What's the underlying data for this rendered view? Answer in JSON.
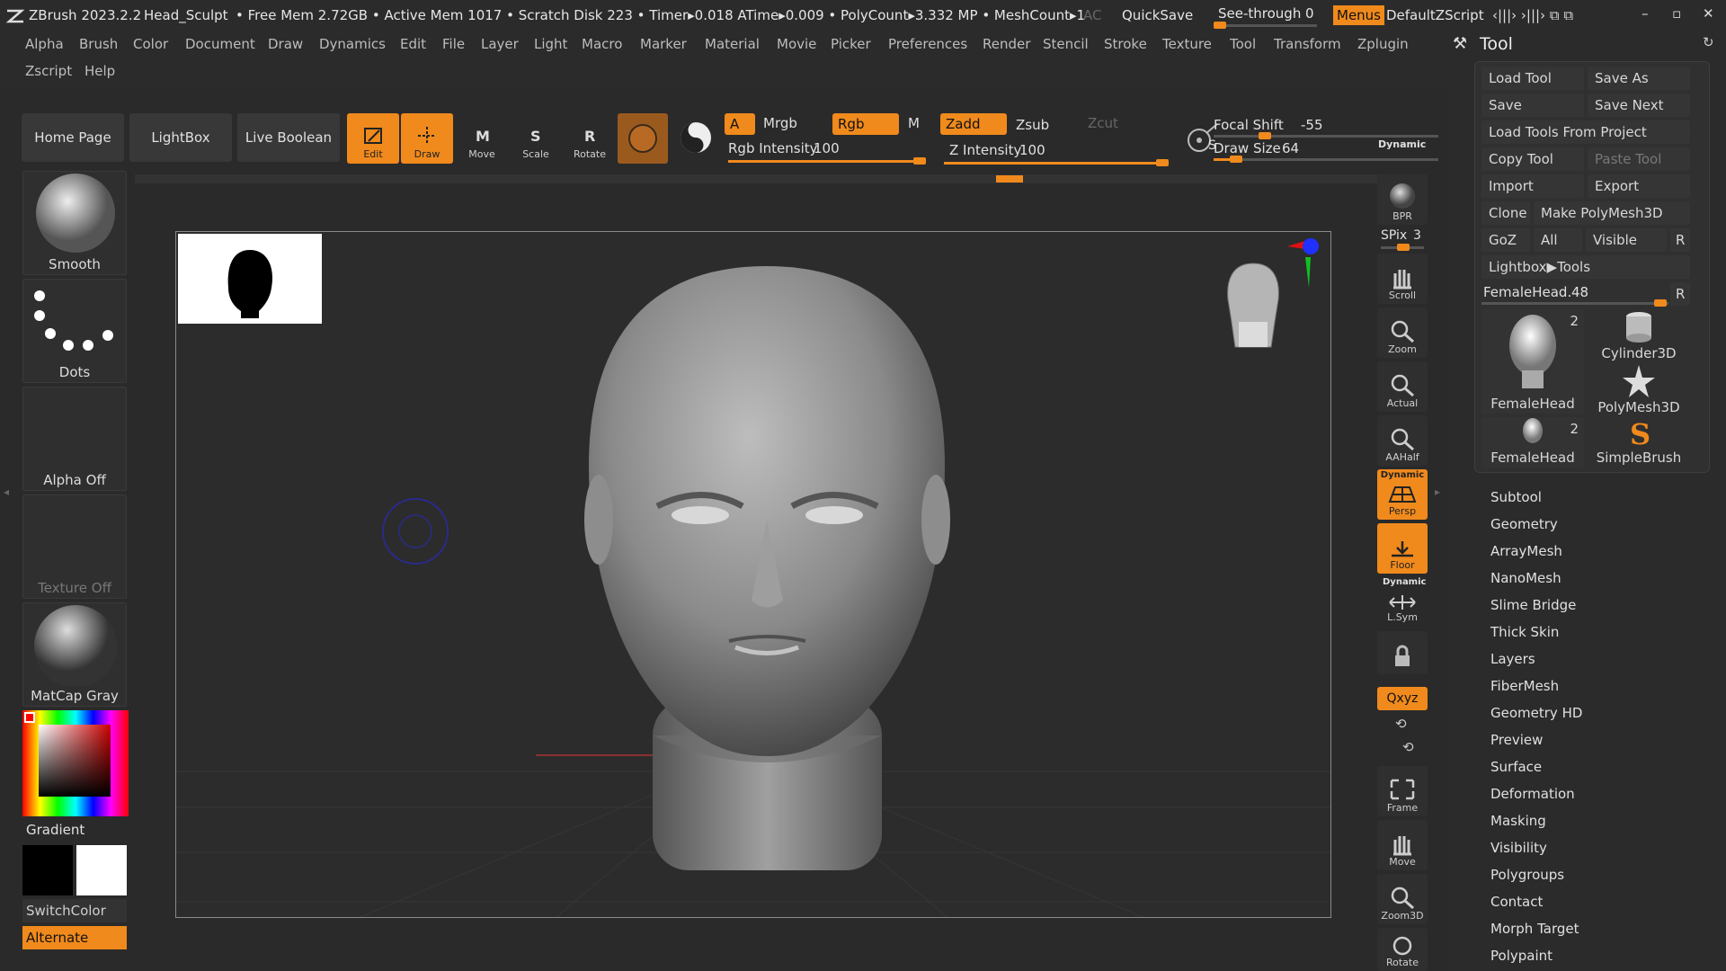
{
  "titlebar": {
    "app": "ZBrush 2023.2.2",
    "doc": "Head_Sculpt",
    "stats": "• Free Mem 2.72GB • Active Mem 1017 • Scratch Disk 223 •  Timer▸0.018 ATime▸0.009 • PolyCount▸3.332 MP  • MeshCount▸1",
    "ac": "AC",
    "quicksave": "QuickSave",
    "seethrough": "See-through",
    "seethrough_value": "0",
    "menus": "Menus",
    "script": "DefaultZScript"
  },
  "menus": [
    "Alpha",
    "Brush",
    "Color",
    "Document",
    "Draw",
    "Dynamics",
    "Edit",
    "File",
    "Layer",
    "Light",
    "Macro",
    "Marker",
    "Material",
    "Movie",
    "Picker",
    "Preferences",
    "Render",
    "Stencil",
    "Stroke",
    "Texture",
    "Tool",
    "Transform",
    "Zplugin",
    "Zscript",
    "Help"
  ],
  "shelf": {
    "home": "Home Page",
    "lightbox": "LightBox",
    "liveboolean": "Live Boolean",
    "edit": "Edit",
    "draw": "Draw",
    "move": "Move",
    "scale": "Scale",
    "rotate": "Rotate",
    "a": "A",
    "mrgb": "Mrgb",
    "rgb": "Rgb",
    "m": "M",
    "zadd": "Zadd",
    "zsub": "Zsub",
    "zcut": "Zcut",
    "rgb_intensity_label": "Rgb Intensity",
    "rgb_intensity": "100",
    "z_intensity_label": "Z Intensity",
    "z_intensity": "100",
    "focal_label": "Focal Shift",
    "focal": "-55",
    "draw_size_label": "Draw Size",
    "draw_size": "64",
    "dynamic": "Dynamic",
    "s": "S"
  },
  "left": {
    "brush": "Smooth",
    "stroke": "Dots",
    "alpha": "Alpha Off",
    "texture": "Texture Off",
    "material": "MatCap Gray",
    "gradient": "Gradient",
    "switchcolor": "SwitchColor",
    "alternate": "Alternate"
  },
  "nav": {
    "bpr": "BPR",
    "spix_label": "SPix",
    "spix": "3",
    "scroll": "Scroll",
    "zoom": "Zoom",
    "actual": "Actual",
    "aahalf": "AAHalf",
    "dynamic": "Dynamic",
    "persp": "Persp",
    "floor": "Floor",
    "dynamic2": "Dynamic",
    "lsym": "L.Sym",
    "xyz": "Qxyz",
    "frame": "Frame",
    "move": "Move",
    "zoom3d": "Zoom3D",
    "rotate": "Rotate"
  },
  "tool": {
    "title": "Tool",
    "load": "Load Tool",
    "saveas": "Save As",
    "save": "Save",
    "savenext": "Save Next",
    "loadproject": "Load Tools From Project",
    "copy": "Copy Tool",
    "paste": "Paste Tool",
    "import": "Import",
    "export": "Export",
    "clone": "Clone",
    "makepoly": "Make PolyMesh3D",
    "goz": "GoZ",
    "all": "All",
    "visible": "Visible",
    "r": "R",
    "lightboxtools": "Lightbox▶Tools",
    "current": "FemaleHead.",
    "current_value": "48",
    "r2": "R",
    "thumbs": [
      {
        "name": "FemaleHead",
        "badge": "2"
      },
      {
        "name": "Cylinder3D",
        "badge": ""
      },
      {
        "name": "PolyMesh3D",
        "badge": ""
      },
      {
        "name": "FemaleHead",
        "badge": "2"
      },
      {
        "name": "SimpleBrush",
        "badge": ""
      }
    ],
    "subpalettes": [
      "Subtool",
      "Geometry",
      "ArrayMesh",
      "NanoMesh",
      "Slime Bridge",
      "Thick Skin",
      "Layers",
      "FiberMesh",
      "Geometry HD",
      "Preview",
      "Surface",
      "Deformation",
      "Masking",
      "Visibility",
      "Polygroups",
      "Contact",
      "Morph Target",
      "Polypaint"
    ]
  },
  "colors": {
    "accent": "#f08a1c",
    "bg": "#2a2a2a",
    "panel": "#353535"
  }
}
